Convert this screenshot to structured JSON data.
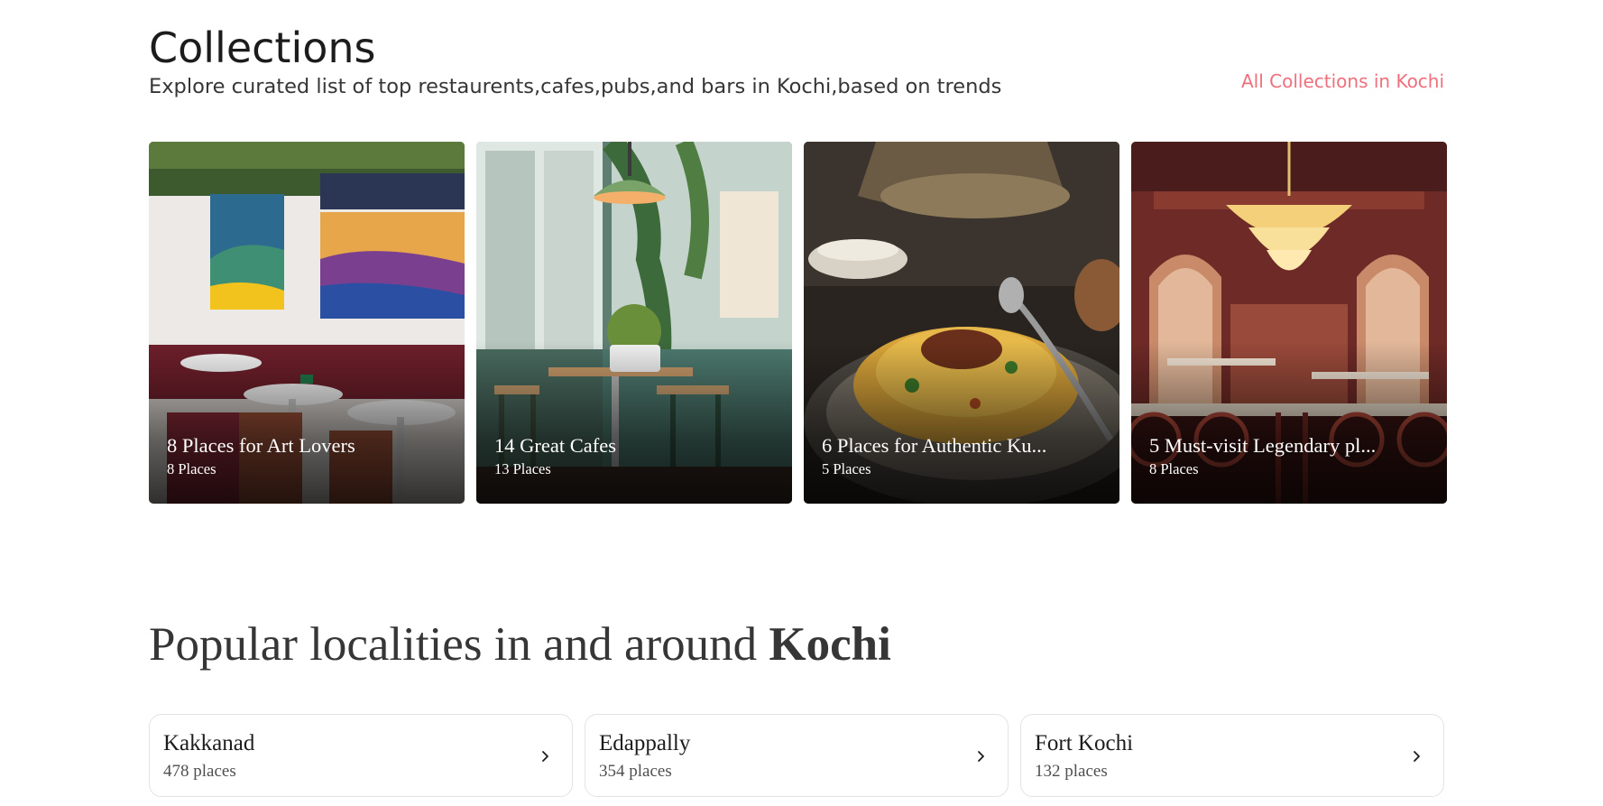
{
  "collections": {
    "title": "Collections",
    "subtitle": "Explore curated list of top restaurents,cafes,pubs,and bars in Kochi,based on trends",
    "all_link": "All Collections in Kochi",
    "cards": [
      {
        "title": "8 Places for Art Lovers",
        "count": "8 Places",
        "image": "art-cafe-photo"
      },
      {
        "title": "14 Great Cafes",
        "count": "13 Places",
        "image": "green-cafe-photo"
      },
      {
        "title": "6 Places for Authentic Ku...",
        "count": "5 Places",
        "image": "biryani-plate-photo"
      },
      {
        "title": "5 Must-visit Legendary pl...",
        "count": "8 Places",
        "image": "chandelier-dining-photo"
      }
    ]
  },
  "localities": {
    "heading_prefix": "Popular localities in and around ",
    "heading_city": "Kochi",
    "items": [
      {
        "name": "Kakkanad",
        "count": "478 places"
      },
      {
        "name": "Edappally",
        "count": "354 places"
      },
      {
        "name": "Fort Kochi",
        "count": "132 places"
      }
    ]
  },
  "colors": {
    "accent_link": "#ef6f7d",
    "heading_text": "#1c1c1c",
    "card_border": "#e3e3e3"
  },
  "icons": {
    "locality_arrow": "chevron-right-icon"
  }
}
